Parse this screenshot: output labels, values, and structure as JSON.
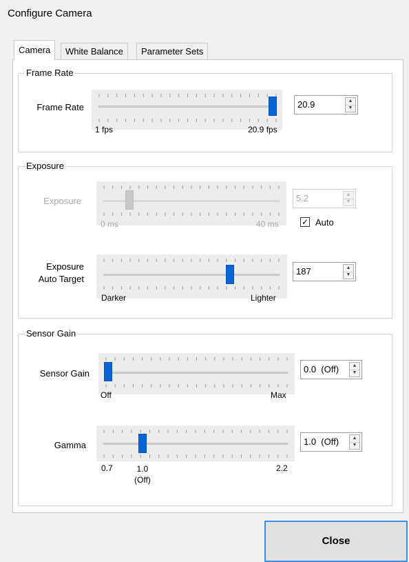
{
  "window": {
    "title": "Configure Camera"
  },
  "tabs": [
    {
      "label": "Camera",
      "active": true
    },
    {
      "label": "White Balance",
      "active": false
    },
    {
      "label": "Parameter Sets",
      "active": false
    }
  ],
  "frame_rate": {
    "group_label": "Frame Rate",
    "label": "Frame Rate",
    "min_label": "1 fps",
    "max_label": "20.9 fps",
    "value": "20.9",
    "slider_fraction": 1.0
  },
  "exposure": {
    "group_label": "Exposure",
    "exposure_label": "Exposure",
    "exposure_min_label": "0 ms",
    "exposure_max_label": "40 ms",
    "exposure_value": "5.2",
    "exposure_fraction": 0.13,
    "exposure_enabled": false,
    "auto_label": "Auto",
    "auto_checked": true,
    "target_label_line1": "Exposure",
    "target_label_line2": "Auto Target",
    "target_min_label": "Darker",
    "target_max_label": "Lighter",
    "target_value": "187",
    "target_fraction": 0.73
  },
  "sensor_gain": {
    "group_label": "Sensor Gain",
    "gain_label": "Sensor Gain",
    "gain_min_label": "Off",
    "gain_max_label": "Max",
    "gain_value": "0.0  (Off)",
    "gain_fraction": 0.0,
    "gamma_label": "Gamma",
    "gamma_min_label": "0.7",
    "gamma_mid_label_line1": "1.0",
    "gamma_mid_label_line2": "(Off)",
    "gamma_max_label": "2.2",
    "gamma_value": "1.0  (Off)",
    "gamma_fraction": 0.2
  },
  "footer": {
    "close_label": "Close"
  },
  "colors": {
    "accent": "#0a64d6",
    "close_border": "#3c8de0"
  }
}
